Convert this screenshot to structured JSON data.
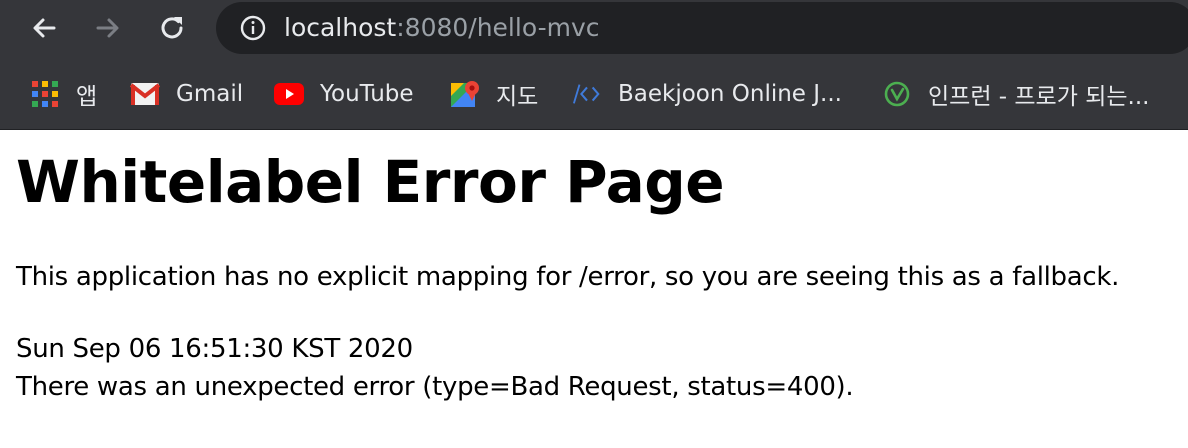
{
  "browser": {
    "address_bar": {
      "host": "localhost",
      "rest": ":8080/hello-mvc"
    },
    "bookmarks": [
      {
        "label": "앱",
        "icon": "apps-grid-icon"
      },
      {
        "label": "Gmail",
        "icon": "gmail-icon"
      },
      {
        "label": "YouTube",
        "icon": "youtube-icon"
      },
      {
        "label": "지도",
        "icon": "maps-icon"
      },
      {
        "label": "Baekjoon Online J...",
        "icon": "code-icon"
      },
      {
        "label": "인프런 - 프로가 되는...",
        "icon": "inflearn-icon"
      }
    ]
  },
  "page": {
    "title": "Whitelabel Error Page",
    "message": "This application has no explicit mapping for /error, so you are seeing this as a fallback.",
    "timestamp": "Sun Sep 06 16:51:30 KST 2020",
    "error": "There was an unexpected error (type=Bad Request, status=400)."
  }
}
